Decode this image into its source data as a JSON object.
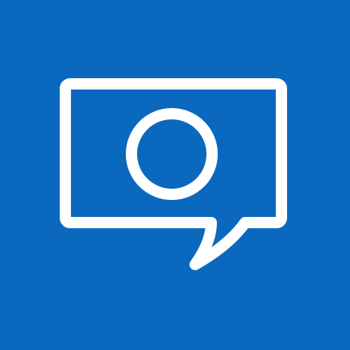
{
  "icon": {
    "name": "speech-bubble-with-circle-icon",
    "background_color": "#0A68BE",
    "stroke_color": "#FFFFFF"
  }
}
